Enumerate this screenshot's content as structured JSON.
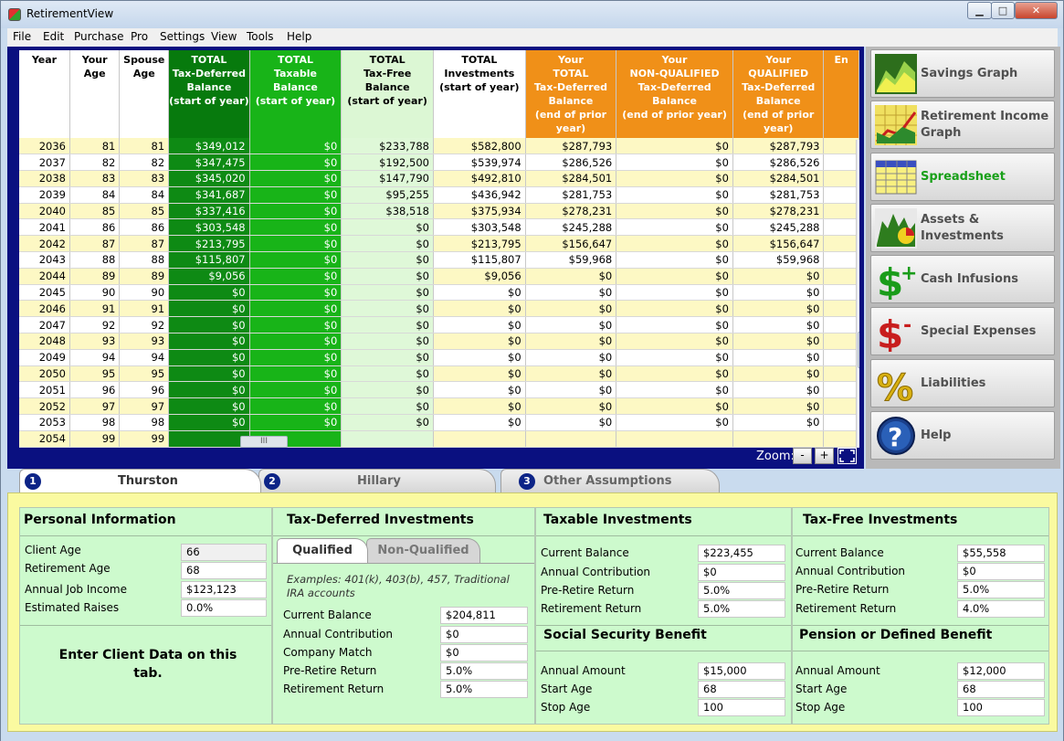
{
  "window": {
    "title": "RetirementView",
    "minimize": "▁",
    "maximize": "□",
    "close": "✕"
  },
  "menu": [
    "File",
    "Edit",
    "Purchase",
    "Pro",
    "Settings",
    "View",
    "Tools",
    "Help"
  ],
  "grid": {
    "headers": [
      [
        "Year"
      ],
      [
        "Your",
        "Age"
      ],
      [
        "Spouse",
        "Age"
      ],
      [
        "TOTAL",
        "Tax-Deferred",
        "Balance",
        "(start of year)"
      ],
      [
        "TOTAL",
        "Taxable",
        "Balance",
        "(start of year)"
      ],
      [
        "TOTAL",
        "Tax-Free",
        "Balance",
        "(start of year)"
      ],
      [
        "TOTAL",
        "Investments",
        "(start of year)"
      ],
      [
        "Your",
        "TOTAL",
        "Tax-Deferred",
        "Balance",
        "(end of prior",
        "year)"
      ],
      [
        "Your",
        "NON-QUALIFIED",
        "Tax-Deferred",
        "Balance",
        "(end of prior year)"
      ],
      [
        "Your",
        "QUALIFIED",
        "Tax-Deferred",
        "Balance",
        "(end of prior",
        "year)"
      ],
      [
        "En"
      ]
    ],
    "rows": [
      [
        "2036",
        "81",
        "81",
        "$349,012",
        "$0",
        "$233,788",
        "$582,800",
        "$287,793",
        "$0",
        "$287,793"
      ],
      [
        "2037",
        "82",
        "82",
        "$347,475",
        "$0",
        "$192,500",
        "$539,974",
        "$286,526",
        "$0",
        "$286,526"
      ],
      [
        "2038",
        "83",
        "83",
        "$345,020",
        "$0",
        "$147,790",
        "$492,810",
        "$284,501",
        "$0",
        "$284,501"
      ],
      [
        "2039",
        "84",
        "84",
        "$341,687",
        "$0",
        "$95,255",
        "$436,942",
        "$281,753",
        "$0",
        "$281,753"
      ],
      [
        "2040",
        "85",
        "85",
        "$337,416",
        "$0",
        "$38,518",
        "$375,934",
        "$278,231",
        "$0",
        "$278,231"
      ],
      [
        "2041",
        "86",
        "86",
        "$303,548",
        "$0",
        "$0",
        "$303,548",
        "$245,288",
        "$0",
        "$245,288"
      ],
      [
        "2042",
        "87",
        "87",
        "$213,795",
        "$0",
        "$0",
        "$213,795",
        "$156,647",
        "$0",
        "$156,647"
      ],
      [
        "2043",
        "88",
        "88",
        "$115,807",
        "$0",
        "$0",
        "$115,807",
        "$59,968",
        "$0",
        "$59,968"
      ],
      [
        "2044",
        "89",
        "89",
        "$9,056",
        "$0",
        "$0",
        "$9,056",
        "$0",
        "$0",
        "$0"
      ],
      [
        "2045",
        "90",
        "90",
        "$0",
        "$0",
        "$0",
        "$0",
        "$0",
        "$0",
        "$0"
      ],
      [
        "2046",
        "91",
        "91",
        "$0",
        "$0",
        "$0",
        "$0",
        "$0",
        "$0",
        "$0"
      ],
      [
        "2047",
        "92",
        "92",
        "$0",
        "$0",
        "$0",
        "$0",
        "$0",
        "$0",
        "$0"
      ],
      [
        "2048",
        "93",
        "93",
        "$0",
        "$0",
        "$0",
        "$0",
        "$0",
        "$0",
        "$0"
      ],
      [
        "2049",
        "94",
        "94",
        "$0",
        "$0",
        "$0",
        "$0",
        "$0",
        "$0",
        "$0"
      ],
      [
        "2050",
        "95",
        "95",
        "$0",
        "$0",
        "$0",
        "$0",
        "$0",
        "$0",
        "$0"
      ],
      [
        "2051",
        "96",
        "96",
        "$0",
        "$0",
        "$0",
        "$0",
        "$0",
        "$0",
        "$0"
      ],
      [
        "2052",
        "97",
        "97",
        "$0",
        "$0",
        "$0",
        "$0",
        "$0",
        "$0",
        "$0"
      ],
      [
        "2053",
        "98",
        "98",
        "$0",
        "$0",
        "$0",
        "$0",
        "$0",
        "$0",
        "$0"
      ],
      [
        "2054",
        "99",
        "99",
        "",
        "",
        "",
        "",
        "",
        "",
        ""
      ]
    ],
    "zoom_label": "Zoom:",
    "zoom_out": "-",
    "zoom_in": "+",
    "scroll_grip": "III"
  },
  "sidebar": [
    {
      "label": "Savings Graph",
      "icon": "savings-graph-icon",
      "active": false
    },
    {
      "label": "Retirement Income Graph",
      "icon": "retirement-income-graph-icon",
      "active": false
    },
    {
      "label": "Spreadsheet",
      "icon": "spreadsheet-icon",
      "active": true
    },
    {
      "label": "Assets & Investments",
      "icon": "assets-investments-icon",
      "active": false
    },
    {
      "label": "Cash Infusions",
      "icon": "cash-infusions-icon",
      "active": false
    },
    {
      "label": "Special Expenses",
      "icon": "special-expenses-icon",
      "active": false
    },
    {
      "label": "Liabilities",
      "icon": "liabilities-icon",
      "active": false
    },
    {
      "label": "Help",
      "icon": "help-icon",
      "active": false
    }
  ],
  "tabs": [
    {
      "num": "1",
      "label": "Thurston",
      "active": true
    },
    {
      "num": "2",
      "label": "Hillary",
      "active": false
    },
    {
      "num": "3",
      "label": "Other Assumptions",
      "active": false
    }
  ],
  "personal": {
    "title": "Personal Information",
    "fields": [
      {
        "label": "Client Age",
        "value": "66"
      },
      {
        "label": "Retirement Age",
        "value": "68"
      },
      {
        "label": "Annual Job Income",
        "value": "$123,123"
      },
      {
        "label": "Estimated Raises",
        "value": "0.0%"
      }
    ],
    "note": "Enter Client Data on this tab."
  },
  "taxdeferred": {
    "title": "Tax-Deferred Investments",
    "subtabs": [
      "Qualified",
      "Non-Qualified"
    ],
    "examples": "Examples: 401(k), 403(b), 457, Traditional IRA accounts",
    "fields": [
      {
        "label": "Current Balance",
        "value": "$204,811"
      },
      {
        "label": "Annual Contribution",
        "value": "$0"
      },
      {
        "label": "Company Match",
        "value": "$0"
      },
      {
        "label": "Pre-Retire Return",
        "value": "5.0%"
      },
      {
        "label": "Retirement Return",
        "value": "5.0%"
      }
    ]
  },
  "taxable": {
    "title": "Taxable Investments",
    "fields": [
      {
        "label": "Current Balance",
        "value": "$223,455"
      },
      {
        "label": "Annual Contribution",
        "value": "$0"
      },
      {
        "label": "Pre-Retire Return",
        "value": "5.0%"
      },
      {
        "label": "Retirement Return",
        "value": "5.0%"
      }
    ]
  },
  "taxfree": {
    "title": "Tax-Free Investments",
    "fields": [
      {
        "label": "Current Balance",
        "value": "$55,558"
      },
      {
        "label": "Annual Contribution",
        "value": "$0"
      },
      {
        "label": "Pre-Retire Return",
        "value": "5.0%"
      },
      {
        "label": "Retirement Return",
        "value": "4.0%"
      }
    ]
  },
  "social": {
    "title": "Social Security Benefit",
    "fields": [
      {
        "label": "Annual Amount",
        "value": "$15,000"
      },
      {
        "label": "Start Age",
        "value": "68"
      },
      {
        "label": "Stop Age",
        "value": "100"
      }
    ]
  },
  "pension": {
    "title": "Pension or Defined Benefit",
    "fields": [
      {
        "label": "Annual Amount",
        "value": "$12,000"
      },
      {
        "label": "Start Age",
        "value": "68"
      },
      {
        "label": "Stop Age",
        "value": "100"
      }
    ]
  }
}
